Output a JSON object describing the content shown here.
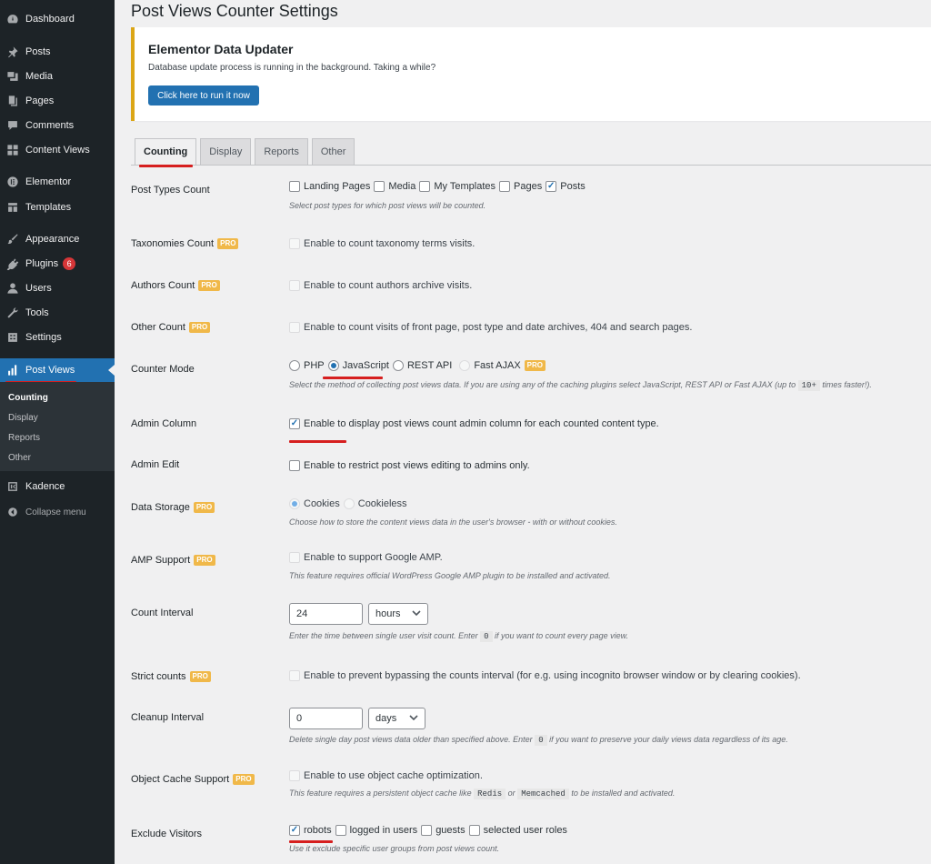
{
  "sidebar": {
    "items": [
      {
        "label": "Dashboard",
        "icon": "dashboard-icon"
      },
      {
        "label": "Posts",
        "icon": "pin-icon"
      },
      {
        "label": "Media",
        "icon": "media-icon"
      },
      {
        "label": "Pages",
        "icon": "pages-icon"
      },
      {
        "label": "Comments",
        "icon": "comments-icon"
      },
      {
        "label": "Content Views",
        "icon": "content-views-icon"
      },
      {
        "label": "Elementor",
        "icon": "elementor-icon"
      },
      {
        "label": "Templates",
        "icon": "templates-icon"
      },
      {
        "label": "Appearance",
        "icon": "brush-icon"
      },
      {
        "label": "Plugins",
        "icon": "plugin-icon",
        "badge": "6"
      },
      {
        "label": "Users",
        "icon": "users-icon"
      },
      {
        "label": "Tools",
        "icon": "wrench-icon"
      },
      {
        "label": "Settings",
        "icon": "settings-icon"
      },
      {
        "label": "Post Views",
        "icon": "bar-chart-icon"
      },
      {
        "label": "Kadence",
        "icon": "kadence-icon"
      }
    ],
    "submenu": [
      "Counting",
      "Display",
      "Reports",
      "Other"
    ],
    "collapse_label": "Collapse menu"
  },
  "page_title": "Post Views Counter Settings",
  "notice": {
    "title": "Elementor Data Updater",
    "text": "Database update process is running in the background. Taking a while?",
    "button": "Click here to run it now"
  },
  "tabs": [
    "Counting",
    "Display",
    "Reports",
    "Other"
  ],
  "pro_label": "PRO",
  "settings": {
    "post_types": {
      "label": "Post Types Count",
      "options": [
        {
          "label": "Landing Pages",
          "checked": false
        },
        {
          "label": "Media",
          "checked": false
        },
        {
          "label": "My Templates",
          "checked": false
        },
        {
          "label": "Pages",
          "checked": false
        },
        {
          "label": "Posts",
          "checked": true
        }
      ],
      "desc": "Select post types for which post views will be counted."
    },
    "taxonomies": {
      "label": "Taxonomies Count",
      "text": "Enable to count taxonomy terms visits."
    },
    "authors": {
      "label": "Authors Count",
      "text": "Enable to count authors archive visits."
    },
    "other": {
      "label": "Other Count",
      "text": "Enable to count visits of front page, post type and date archives, 404 and search pages."
    },
    "counter_mode": {
      "label": "Counter Mode",
      "options": [
        "PHP",
        "JavaScript",
        "REST API",
        "Fast AJAX"
      ],
      "selected": "JavaScript",
      "desc_before": "Select the method of collecting post views data. If you are using any of the caching plugins select JavaScript, REST API or Fast AJAX (up to",
      "desc_code": "10+",
      "desc_after": "times faster!)."
    },
    "admin_column": {
      "label": "Admin Column",
      "text": "Enable to display post views count admin column for each counted content type.",
      "checked": true
    },
    "admin_edit": {
      "label": "Admin Edit",
      "text": "Enable to restrict post views editing to admins only.",
      "checked": false
    },
    "data_storage": {
      "label": "Data Storage",
      "options": [
        "Cookies",
        "Cookieless"
      ],
      "selected": "Cookies",
      "desc": "Choose how to store the content views data in the user's browser - with or without cookies."
    },
    "amp": {
      "label": "AMP Support",
      "text": "Enable to support Google AMP.",
      "desc": "This feature requires official WordPress Google AMP plugin to be installed and activated."
    },
    "count_interval": {
      "label": "Count Interval",
      "value": "24",
      "unit": "hours",
      "desc_before": "Enter the time between single user visit count. Enter",
      "desc_code": "0",
      "desc_after": "if you want to count every page view."
    },
    "strict_counts": {
      "label": "Strict counts",
      "text": "Enable to prevent bypassing the counts interval (for e.g. using incognito browser window or by clearing cookies)."
    },
    "cleanup_interval": {
      "label": "Cleanup Interval",
      "value": "0",
      "unit": "days",
      "desc_before": "Delete single day post views data older than specified above. Enter",
      "desc_code": "0",
      "desc_after": "if you want to preserve your daily views data regardless of its age."
    },
    "object_cache": {
      "label": "Object Cache Support",
      "text": "Enable to use object cache optimization.",
      "desc_before": "This feature requires a persistent object cache like",
      "desc_code1": "Redis",
      "desc_mid": "or",
      "desc_code2": "Memcached",
      "desc_after": "to be installed and activated."
    },
    "exclude_visitors": {
      "label": "Exclude Visitors",
      "options": [
        {
          "label": "robots",
          "checked": true
        },
        {
          "label": "logged in users",
          "checked": false
        },
        {
          "label": "guests",
          "checked": false
        },
        {
          "label": "selected user roles",
          "checked": false
        }
      ],
      "desc": "Use it exclude specific user groups from post views count."
    }
  },
  "colors": {
    "sidebar_bg": "#1d2327",
    "active_menu": "#2271b1",
    "notice_border": "#dba617",
    "pro_badge": "#f0b849",
    "annotation_red": "#d61f1f"
  }
}
